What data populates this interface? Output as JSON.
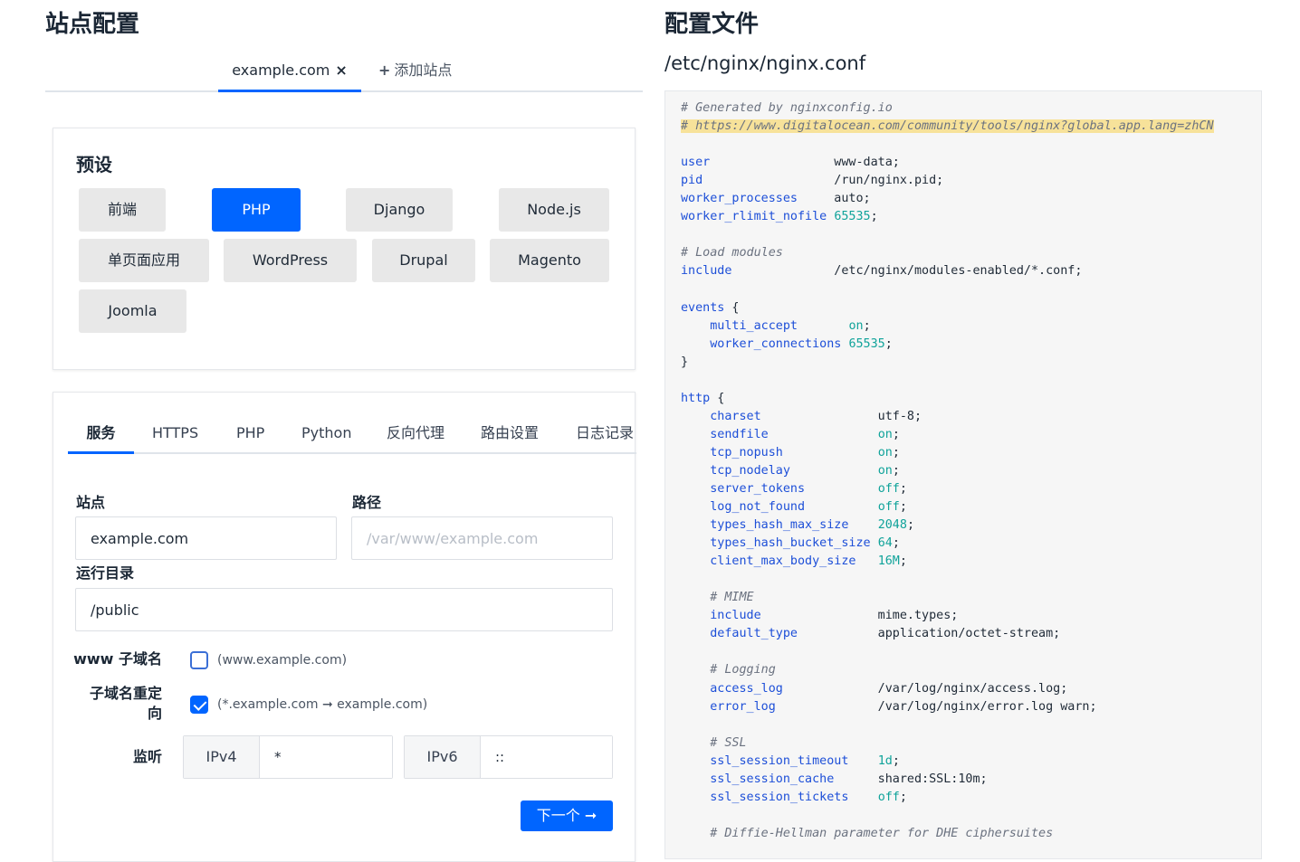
{
  "left": {
    "title": "站点配置",
    "site_tabs": {
      "active_label": "example.com",
      "close_glyph": "×",
      "add_label": "添加站点",
      "add_glyph": "+"
    },
    "presets": {
      "title": "预设",
      "buttons": [
        "前端",
        "PHP",
        "Django",
        "Node.js",
        "单页面应用",
        "WordPress",
        "Drupal",
        "Magento",
        "Joomla"
      ],
      "active": "PHP"
    },
    "config_tabs": [
      "服务",
      "HTTPS",
      "PHP",
      "Python",
      "反向代理",
      "路由设置",
      "日志记录"
    ],
    "active_config_tab": "服务",
    "form": {
      "site_label": "站点",
      "site_value": "example.com",
      "path_label": "路径",
      "path_placeholder": "/var/www/example.com",
      "docroot_label": "运行目录",
      "docroot_value": "/public",
      "www_label": "www 子域名",
      "www_checked": false,
      "www_hint": "(www.example.com)",
      "redirect_label_1": "子域名重定",
      "redirect_label_2": "向",
      "redirect_checked": true,
      "redirect_hint": "(*.example.com ➞ example.com)",
      "listen_label": "监听",
      "ipv4_label": "IPv4",
      "ipv4_value": "*",
      "ipv6_label": "IPv6",
      "ipv6_value": "::",
      "next_label": "下一个 ➞"
    }
  },
  "right": {
    "title": "配置文件",
    "file_path": "/etc/nginx/nginx.conf",
    "code_lines": [
      [
        {
          "t": "# Generated by nginxconfig.io",
          "c": "cmt"
        }
      ],
      [
        {
          "t": "# https://www.digitalocean.com/community/tools/nginx?global.app.lang=zhCN",
          "c": "cmt hl"
        }
      ],
      [],
      [
        {
          "t": "user",
          "c": "kw"
        },
        {
          "t": "                 www-data;"
        }
      ],
      [
        {
          "t": "pid",
          "c": "kw"
        },
        {
          "t": "                  /run/nginx.pid;"
        }
      ],
      [
        {
          "t": "worker_processes",
          "c": "kw"
        },
        {
          "t": "     auto;"
        }
      ],
      [
        {
          "t": "worker_rlimit_nofile",
          "c": "kw"
        },
        {
          "t": " "
        },
        {
          "t": "65535",
          "c": "num"
        },
        {
          "t": ";"
        }
      ],
      [],
      [
        {
          "t": "# Load modules",
          "c": "cmt"
        }
      ],
      [
        {
          "t": "include",
          "c": "kw"
        },
        {
          "t": "              /etc/nginx/modules-enabled/*.conf;"
        }
      ],
      [],
      [
        {
          "t": "events",
          "c": "kw"
        },
        {
          "t": " {"
        }
      ],
      [
        {
          "t": "    "
        },
        {
          "t": "multi_accept",
          "c": "kw"
        },
        {
          "t": "       "
        },
        {
          "t": "on",
          "c": "num"
        },
        {
          "t": ";"
        }
      ],
      [
        {
          "t": "    "
        },
        {
          "t": "worker_connections",
          "c": "kw"
        },
        {
          "t": " "
        },
        {
          "t": "65535",
          "c": "num"
        },
        {
          "t": ";"
        }
      ],
      [
        {
          "t": "}"
        }
      ],
      [],
      [
        {
          "t": "http",
          "c": "kw"
        },
        {
          "t": " {"
        }
      ],
      [
        {
          "t": "    "
        },
        {
          "t": "charset",
          "c": "kw"
        },
        {
          "t": "                utf-8;"
        }
      ],
      [
        {
          "t": "    "
        },
        {
          "t": "sendfile",
          "c": "kw"
        },
        {
          "t": "               "
        },
        {
          "t": "on",
          "c": "num"
        },
        {
          "t": ";"
        }
      ],
      [
        {
          "t": "    "
        },
        {
          "t": "tcp_nopush",
          "c": "kw"
        },
        {
          "t": "             "
        },
        {
          "t": "on",
          "c": "num"
        },
        {
          "t": ";"
        }
      ],
      [
        {
          "t": "    "
        },
        {
          "t": "tcp_nodelay",
          "c": "kw"
        },
        {
          "t": "            "
        },
        {
          "t": "on",
          "c": "num"
        },
        {
          "t": ";"
        }
      ],
      [
        {
          "t": "    "
        },
        {
          "t": "server_tokens",
          "c": "kw"
        },
        {
          "t": "          "
        },
        {
          "t": "off",
          "c": "num"
        },
        {
          "t": ";"
        }
      ],
      [
        {
          "t": "    "
        },
        {
          "t": "log_not_found",
          "c": "kw"
        },
        {
          "t": "          "
        },
        {
          "t": "off",
          "c": "num"
        },
        {
          "t": ";"
        }
      ],
      [
        {
          "t": "    "
        },
        {
          "t": "types_hash_max_size",
          "c": "kw"
        },
        {
          "t": "    "
        },
        {
          "t": "2048",
          "c": "num"
        },
        {
          "t": ";"
        }
      ],
      [
        {
          "t": "    "
        },
        {
          "t": "types_hash_bucket_size",
          "c": "kw"
        },
        {
          "t": " "
        },
        {
          "t": "64",
          "c": "num"
        },
        {
          "t": ";"
        }
      ],
      [
        {
          "t": "    "
        },
        {
          "t": "client_max_body_size",
          "c": "kw"
        },
        {
          "t": "   "
        },
        {
          "t": "16M",
          "c": "num"
        },
        {
          "t": ";"
        }
      ],
      [],
      [
        {
          "t": "    "
        },
        {
          "t": "# MIME",
          "c": "cmt"
        }
      ],
      [
        {
          "t": "    "
        },
        {
          "t": "include",
          "c": "kw"
        },
        {
          "t": "                mime.types;"
        }
      ],
      [
        {
          "t": "    "
        },
        {
          "t": "default_type",
          "c": "kw"
        },
        {
          "t": "           application/octet-stream;"
        }
      ],
      [],
      [
        {
          "t": "    "
        },
        {
          "t": "# Logging",
          "c": "cmt"
        }
      ],
      [
        {
          "t": "    "
        },
        {
          "t": "access_log",
          "c": "kw"
        },
        {
          "t": "             /var/log/nginx/access.log;"
        }
      ],
      [
        {
          "t": "    "
        },
        {
          "t": "error_log",
          "c": "kw"
        },
        {
          "t": "              /var/log/nginx/error.log warn;"
        }
      ],
      [],
      [
        {
          "t": "    "
        },
        {
          "t": "# SSL",
          "c": "cmt"
        }
      ],
      [
        {
          "t": "    "
        },
        {
          "t": "ssl_session_timeout",
          "c": "kw"
        },
        {
          "t": "    "
        },
        {
          "t": "1d",
          "c": "num"
        },
        {
          "t": ";"
        }
      ],
      [
        {
          "t": "    "
        },
        {
          "t": "ssl_session_cache",
          "c": "kw"
        },
        {
          "t": "      shared:SSL:10m;"
        }
      ],
      [
        {
          "t": "    "
        },
        {
          "t": "ssl_session_tickets",
          "c": "kw"
        },
        {
          "t": "    "
        },
        {
          "t": "off",
          "c": "num"
        },
        {
          "t": ";"
        }
      ],
      [],
      [
        {
          "t": "    "
        },
        {
          "t": "# Diffie-Hellman parameter for DHE ciphersuites",
          "c": "cmt"
        }
      ]
    ]
  }
}
